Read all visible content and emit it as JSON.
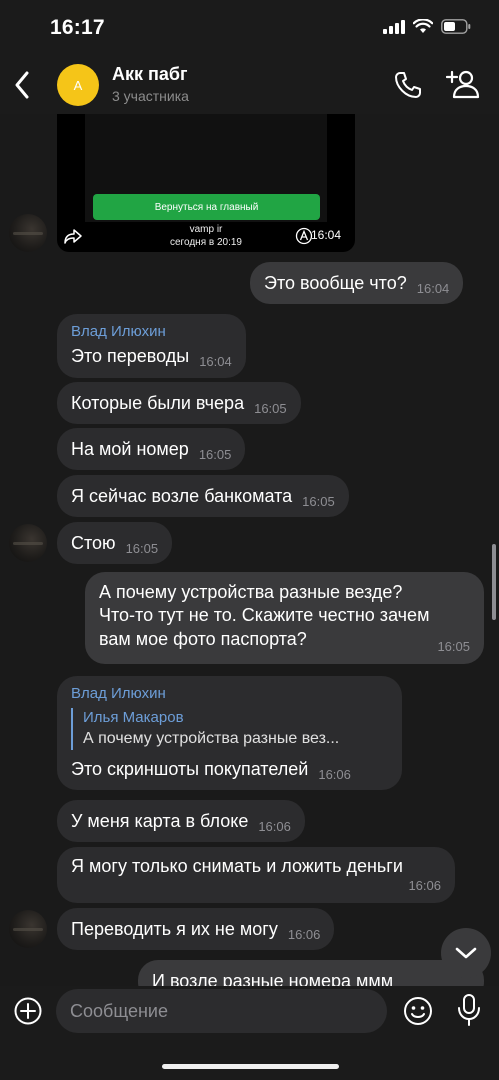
{
  "status_bar": {
    "time": "16:17"
  },
  "header": {
    "back_icon": "chevron-left-icon",
    "avatar_letter": "A",
    "avatar_color": "#f5c518",
    "title": "Акк пабг",
    "subtitle": "3 участника",
    "call_icon": "phone-icon",
    "add_user_icon": "add-user-icon"
  },
  "image_message": {
    "button_text": "Вернуться на главный",
    "caption_name": "vamp ir",
    "caption_time": "сегодня в 20:19",
    "time": "16:04"
  },
  "messages": [
    {
      "dir": "out",
      "text": "Это вообще что?",
      "time": "16:04"
    },
    {
      "dir": "in",
      "sender": "Влад Илюхин",
      "text": "Это переводы",
      "time": "16:04"
    },
    {
      "dir": "in",
      "text": "Которые были вчера",
      "time": "16:05"
    },
    {
      "dir": "in",
      "text": "На мой номер",
      "time": "16:05"
    },
    {
      "dir": "in",
      "text": "Я сейчас возле банкомата",
      "time": "16:05"
    },
    {
      "dir": "in",
      "text": "Стою",
      "time": "16:05"
    },
    {
      "dir": "out",
      "lines": [
        "А почему устройства разные везде?",
        "Что-то тут не то. Скажите честно зачем",
        "вам мое фото паспорта?"
      ],
      "time": "16:05"
    },
    {
      "dir": "in",
      "sender": "Влад Илюхин",
      "quote_name": "Илья Макаров",
      "quote_text": "А почему устройства разные вез...",
      "text": "Это скриншоты покупателей",
      "time": "16:06"
    },
    {
      "dir": "in",
      "text": "У меня карта в блоке",
      "time": "16:06"
    },
    {
      "dir": "in",
      "text": "Я могу только снимать и ложить деньги",
      "time": "16:06"
    },
    {
      "dir": "in",
      "text": "Переводить я их не могу",
      "time": "16:06"
    },
    {
      "dir": "out",
      "text": "И возле разные номера ммм",
      "partial": true
    }
  ],
  "composer": {
    "placeholder": "Сообщение",
    "attach_icon": "plus-circle-icon",
    "emoji_icon": "emoji-icon",
    "mic_icon": "microphone-icon"
  },
  "scroll_down_icon": "chevron-down-icon"
}
